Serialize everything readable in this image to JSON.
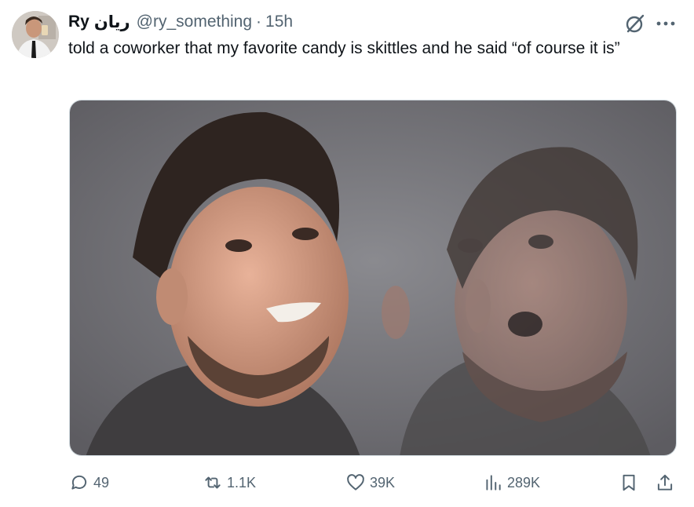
{
  "tweet": {
    "display_name": "Ry",
    "arabic_name": "ريان",
    "handle": "@ry_something",
    "separator": "·",
    "time": "15h",
    "text": "told a coworker that my favorite candy is skittles and he said “of course it is”"
  },
  "media": {
    "description_icon": "photo-of-man-reacting-two-frames"
  },
  "metrics": {
    "replies": "49",
    "reposts": "1.1K",
    "likes": "39K",
    "views": "289K"
  },
  "icons": {
    "reply": "reply-icon",
    "repost": "repost-icon",
    "like": "heart-icon",
    "views": "views-icon",
    "bookmark": "bookmark-icon",
    "share": "share-icon",
    "grok": "grok-icon",
    "more": "more-icon"
  },
  "colors": {
    "text_primary": "#0f1419",
    "text_secondary": "#536471",
    "border": "#cfd9de"
  }
}
